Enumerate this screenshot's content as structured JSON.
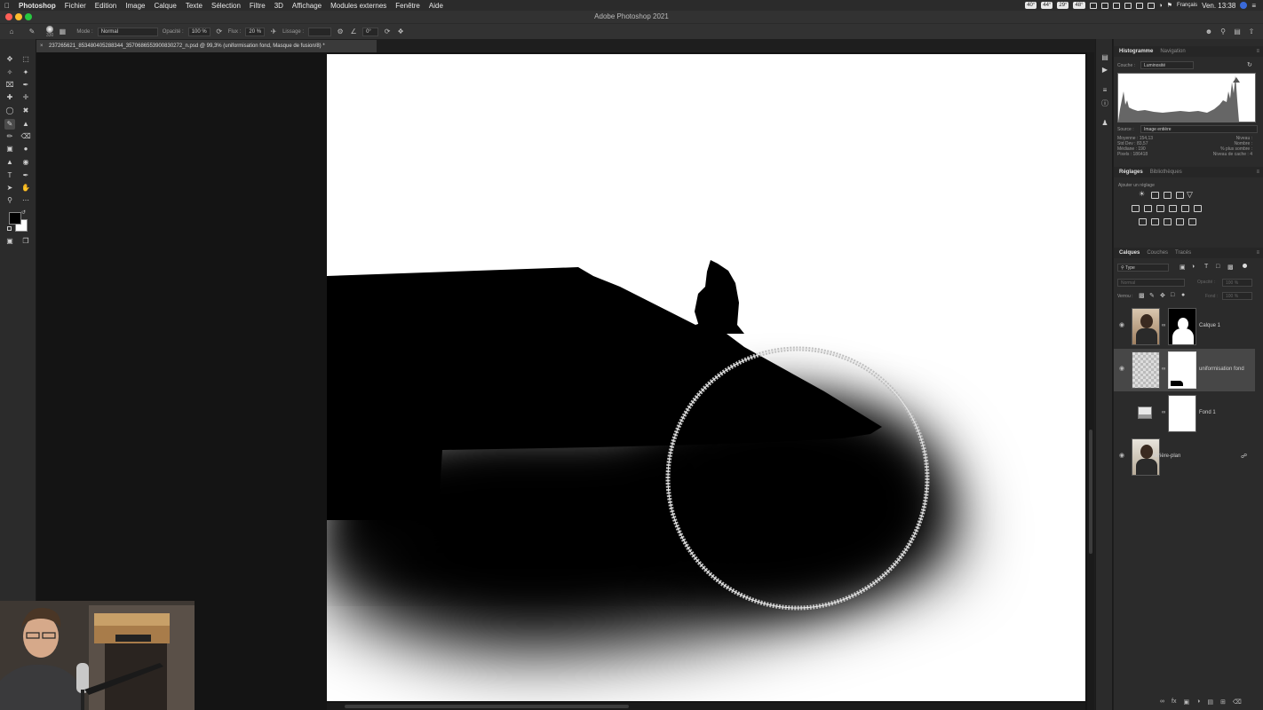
{
  "mac_menubar": {
    "app_name": "Photoshop",
    "items": [
      "Fichier",
      "Edition",
      "Image",
      "Calque",
      "Texte",
      "Sélection",
      "Filtre",
      "3D",
      "Affichage",
      "Modules externes",
      "Fenêtre",
      "Aide"
    ],
    "stats": [
      "40°",
      "44°",
      "29°",
      "48°"
    ],
    "language": "Français",
    "datetime": "Ven. 13:38"
  },
  "window": {
    "title": "Adobe Photoshop 2021"
  },
  "options_bar": {
    "brush_size": "330",
    "mode_label": "Mode :",
    "mode_value": "Normal",
    "opacity_label": "Opacité :",
    "opacity_value": "100 %",
    "flow_label": "Flux :",
    "flow_value": "20 %",
    "smoothing_label": "Lissage :",
    "angle_value": "0°"
  },
  "document": {
    "tab_title": "237265621_853480405288344_3570686553900830272_n.psd @ 99,3% (uniformisation fond, Masque de fusion/8) *"
  },
  "histogram_panel": {
    "tabs": [
      "Histogramme",
      "Navigation"
    ],
    "channel_label": "Couche :",
    "channel_value": "Luminosité",
    "source_label": "Source :",
    "source_value": "Image entière",
    "stats_left": [
      {
        "label": "Moyenne :",
        "value": "154,13"
      },
      {
        "label": "Std Dev :",
        "value": "83,57"
      },
      {
        "label": "Médiane :",
        "value": "190"
      },
      {
        "label": "Pixels :",
        "value": "186418"
      }
    ],
    "stats_right": [
      {
        "label": "Niveau :",
        "value": ""
      },
      {
        "label": "Nombre :",
        "value": ""
      },
      {
        "label": "% plus sombre :",
        "value": ""
      },
      {
        "label": "Niveau de cache :",
        "value": "4"
      }
    ]
  },
  "adjustments_panel": {
    "tabs": [
      "Réglages",
      "Bibliothèques"
    ],
    "subtitle": "Ajouter un réglage"
  },
  "layers_panel": {
    "tabs": [
      "Calques",
      "Couches",
      "Tracés"
    ],
    "filter_value": "Type",
    "blend_value": "Normal",
    "opacity_label": "Opacité :",
    "opacity_value": "100 %",
    "lock_label": "Verrou :",
    "fill_label": "Fond :",
    "fill_value": "100 %",
    "layers": [
      {
        "name": "Calque 1"
      },
      {
        "name": "uniformisation fond"
      },
      {
        "name": "Fond 1"
      },
      {
        "name": "Arrière-plan"
      }
    ]
  },
  "colors": {
    "accent": "#3a6ad9",
    "panel_bg": "#2b2b2b",
    "workspace": "#141414"
  }
}
